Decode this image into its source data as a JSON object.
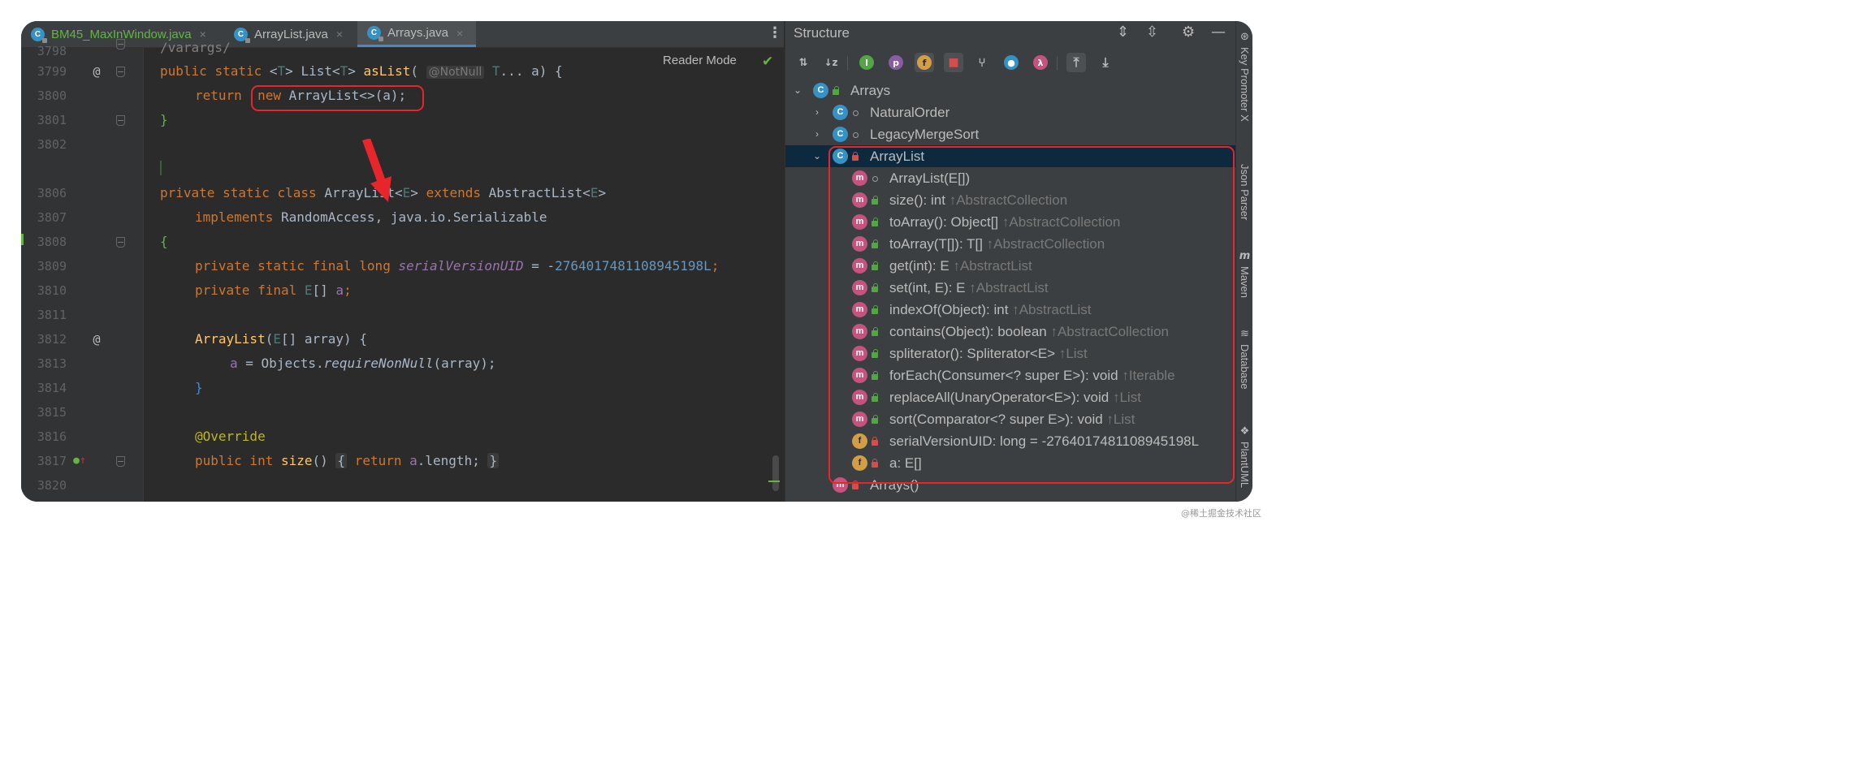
{
  "tabs": [
    {
      "label": "BM45_MaxInWindow.java",
      "close": "×"
    },
    {
      "label": "ArrayList.java",
      "close": "×"
    },
    {
      "label": "Arrays.java",
      "close": "×"
    }
  ],
  "editor": {
    "reader_mode": "Reader Mode",
    "lines": [
      {
        "num": "3798",
        "gutter": ""
      },
      {
        "num": "3799",
        "gutter": "@"
      },
      {
        "num": "3800",
        "gutter": ""
      },
      {
        "num": "3801",
        "gutter": ""
      },
      {
        "num": "3802",
        "gutter": ""
      },
      {
        "num": "",
        "gutter": ""
      },
      {
        "num": "3806",
        "gutter": ""
      },
      {
        "num": "3807",
        "gutter": ""
      },
      {
        "num": "3808",
        "gutter": ""
      },
      {
        "num": "3809",
        "gutter": ""
      },
      {
        "num": "3810",
        "gutter": ""
      },
      {
        "num": "3811",
        "gutter": ""
      },
      {
        "num": "3812",
        "gutter": "@"
      },
      {
        "num": "3813",
        "gutter": ""
      },
      {
        "num": "3814",
        "gutter": ""
      },
      {
        "num": "3815",
        "gutter": ""
      },
      {
        "num": "3816",
        "gutter": ""
      },
      {
        "num": "3817",
        "gutter": ""
      },
      {
        "num": "3820",
        "gutter": ""
      }
    ],
    "code": {
      "l3798": "/varargs/",
      "l3799_public": "public",
      "l3799_static": "static",
      "l3799_generic": "<",
      "l3799_T": "T",
      "l3799_generic_close": ">",
      "l3799_list": "List<",
      "l3799_T2": "T",
      "l3799_list_close": ">",
      "l3799_name": "asList",
      "l3799_paren": "(",
      "l3799_hint": "@NotNull",
      "l3799_T3": "T",
      "l3799_rest": "... a) {",
      "l3800_return": "return",
      "l3800_new": "new",
      "l3800_rest": "ArrayList<>(a);",
      "l3801": "}",
      "l3806_private": "private",
      "l3806_static": "static",
      "l3806_class": "class",
      "l3806_name": "ArrayList<",
      "l3806_E": "E",
      "l3806_close": ">",
      "l3806_extends": "extends",
      "l3806_abs": "AbstractList<",
      "l3806_E2": "E",
      "l3806_close2": ">",
      "l3807_impl": "implements",
      "l3807_rest": "RandomAccess, java.io.Serializable",
      "l3808": "{",
      "l3809_kw": "private static final long",
      "l3809_const": "serialVersionUID",
      "l3809_eq": " = -",
      "l3809_num": "2764017481108945198L",
      "l3809_semi": ";",
      "l3810_kw": "private final",
      "l3810_E": "E",
      "l3810_arr": "[]",
      "l3810_a": "a",
      "l3810_semi": ";",
      "l3812_name": "ArrayList",
      "l3812_paren": "(",
      "l3812_E": "E",
      "l3812_rest": "[] array) {",
      "l3813_a": "a",
      "l3813_eq": " = Objects.",
      "l3813_call": "requireNonNull",
      "l3813_rest": "(array);",
      "l3814": "}",
      "l3816": "@Override",
      "l3817_kw": "public int",
      "l3817_name": "size",
      "l3817_paren": "()",
      "l3817_open": "{",
      "l3817_ret": "return",
      "l3817_a": "a",
      "l3817_rest": ".length;",
      "l3817_close": "}"
    }
  },
  "structure": {
    "title": "Structure",
    "toolbar_icons": [
      "sort-by-visibility-icon",
      "sort-alphabetically-icon",
      "show-inherited-icon",
      "show-properties-icon",
      "show-fields-icon",
      "show-non-public-icon",
      "show-lambdas-icon",
      "anonymous-classes-icon",
      "lambda-icon",
      "autoscroll-to-source-icon",
      "autoscroll-from-source-icon"
    ],
    "toolbar_letters": {
      "p": "p",
      "f": "f",
      "lambda": "λ",
      "inherit": "I"
    },
    "tree": [
      {
        "label": "Arrays",
        "inherited": ""
      },
      {
        "label": "NaturalOrder",
        "inherited": ""
      },
      {
        "label": "LegacyMergeSort",
        "inherited": ""
      },
      {
        "label": "ArrayList",
        "inherited": ""
      },
      {
        "label": "ArrayList(E[])",
        "inherited": ""
      },
      {
        "label": "size(): int",
        "inherited": "↑AbstractCollection"
      },
      {
        "label": "toArray(): Object[]",
        "inherited": "↑AbstractCollection"
      },
      {
        "label": "toArray(T[]): T[]",
        "inherited": "↑AbstractCollection"
      },
      {
        "label": "get(int): E",
        "inherited": "↑AbstractList"
      },
      {
        "label": "set(int, E): E",
        "inherited": "↑AbstractList"
      },
      {
        "label": "indexOf(Object): int",
        "inherited": "↑AbstractList"
      },
      {
        "label": "contains(Object): boolean",
        "inherited": "↑AbstractCollection"
      },
      {
        "label": "spliterator(): Spliterator<E>",
        "inherited": "↑List"
      },
      {
        "label": "forEach(Consumer<? super E>): void",
        "inherited": "↑Iterable"
      },
      {
        "label": "replaceAll(UnaryOperator<E>): void",
        "inherited": "↑List"
      },
      {
        "label": "sort(Comparator<? super E>): void",
        "inherited": "↑List"
      },
      {
        "label": "serialVersionUID: long = -2764017481108945198L",
        "inherited": ""
      },
      {
        "label": "a: E[]",
        "inherited": ""
      },
      {
        "label": "Arrays()",
        "inherited": ""
      }
    ],
    "icon_letters": {
      "class": "C",
      "method": "m",
      "field": "f"
    }
  },
  "sidebar": {
    "items": [
      {
        "label": "Key Promoter X"
      },
      {
        "label": "Json Parser"
      },
      {
        "label": "Maven",
        "icon": "m"
      },
      {
        "label": "Database"
      },
      {
        "label": "PlantUML"
      }
    ]
  },
  "watermark": "@稀土掘金技术社区",
  "colors": {
    "accent": "#4a88c7",
    "annotation_red": "#e8252b",
    "method": "#c6537e",
    "field": "#d49f44",
    "class": "#3592c4"
  }
}
